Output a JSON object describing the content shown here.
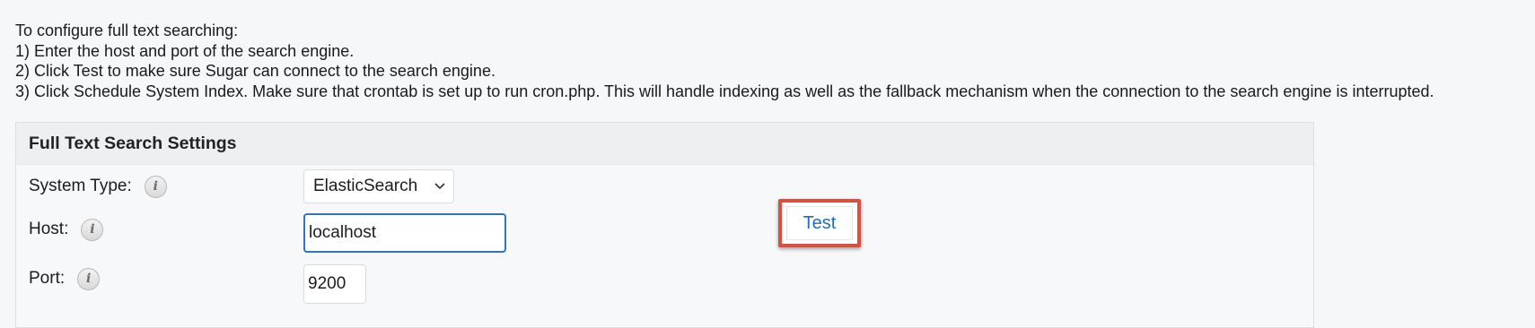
{
  "instructions": {
    "heading": "To configure full text searching:",
    "step1": "1) Enter the host and port of the search engine.",
    "step2": "2) Click Test to make sure Sugar can connect to the search engine.",
    "step3": "3) Click Schedule System Index. Make sure that crontab is set up to run cron.php. This will handle indexing as well as the fallback mechanism when the connection to the search engine is interrupted."
  },
  "panel": {
    "title": "Full Text Search Settings",
    "system_type": {
      "label": "System Type:",
      "value": "ElasticSearch",
      "icon": "info-icon"
    },
    "host": {
      "label": "Host:",
      "value": "localhost",
      "icon": "info-icon"
    },
    "port": {
      "label": "Port:",
      "value": "9200",
      "icon": "info-icon"
    },
    "test_button": "Test",
    "info_icon_glyph": "i"
  },
  "colors": {
    "highlight_border": "#d9503f",
    "link_blue": "#1f6fb5",
    "focus_border": "#2f77b9"
  }
}
